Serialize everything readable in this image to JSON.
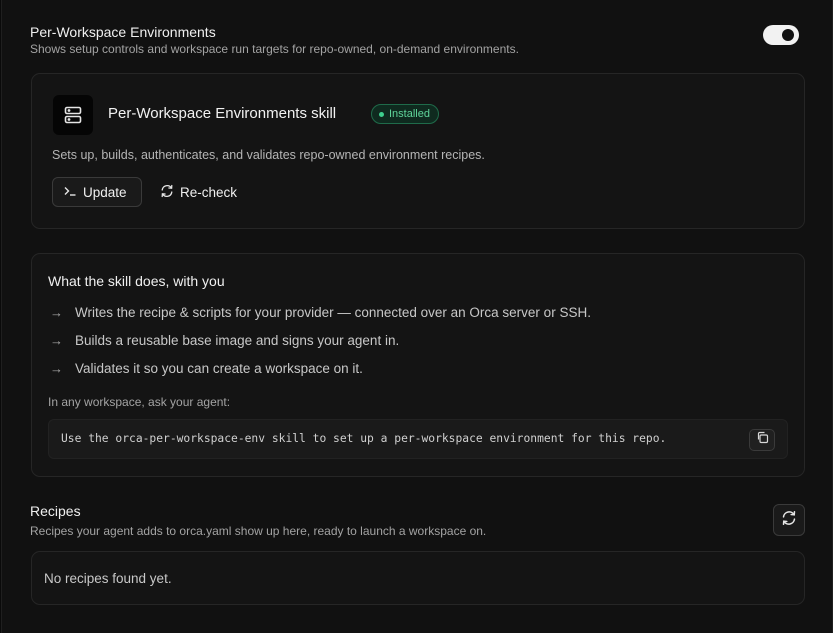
{
  "environments": {
    "title": "Per-Workspace Environments",
    "description": "Shows setup controls and workspace run targets for repo-owned, on-demand environments.",
    "toggle_on": true
  },
  "skill": {
    "icon": "server-icon",
    "name": "Per-Workspace Environments skill",
    "badge": "Installed",
    "badge_color": "#3ecf8e",
    "description": "Sets up, builds, authenticates, and validates repo-owned environment recipes.",
    "update_label": "Update",
    "recheck_label": "Re-check"
  },
  "does": {
    "title": "What the skill does, with you",
    "items": [
      "Writes the recipe & scripts for your provider — connected over an Orca server or SSH.",
      "Builds a reusable base image and signs your agent in.",
      "Validates it so you can create a workspace on it."
    ],
    "ask_label": "In any workspace, ask your agent:",
    "prompt": "Use the orca-per-workspace-env skill to set up a per-workspace environment for this repo."
  },
  "recipes": {
    "title": "Recipes",
    "description": "Recipes your agent adds to orca.yaml show up here, ready to launch a workspace on.",
    "empty_text": "No recipes found yet."
  }
}
